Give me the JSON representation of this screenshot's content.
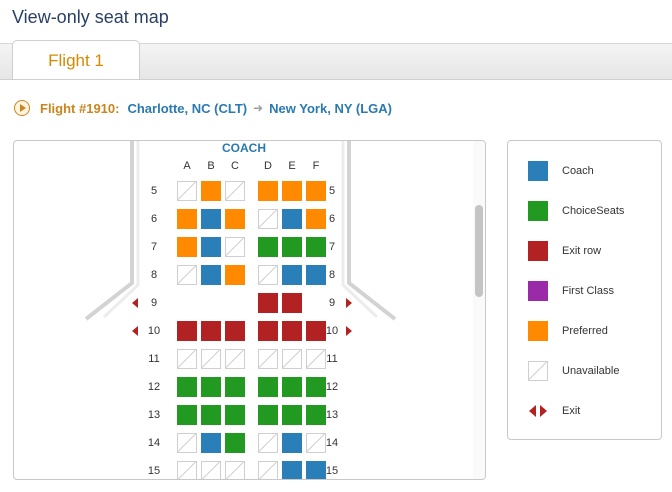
{
  "page": {
    "title": "View-only seat map"
  },
  "tabs": [
    {
      "label": "Flight 1",
      "active": true
    }
  ],
  "flight": {
    "number_label": "Flight #1910:",
    "origin": "Charlotte, NC  (CLT)",
    "destination": "New York, NY  (LGA)"
  },
  "seat_map": {
    "cabin": "COACH",
    "columns_left": [
      "A",
      "B",
      "C"
    ],
    "columns_right": [
      "D",
      "E",
      "F"
    ],
    "rows": [
      {
        "num": "5",
        "seats": [
          "unavailable",
          "preferred",
          "unavailable",
          "preferred",
          "preferred",
          "preferred"
        ],
        "exit": false
      },
      {
        "num": "6",
        "seats": [
          "preferred",
          "coach",
          "preferred",
          "unavailable",
          "coach",
          "preferred"
        ],
        "exit": false
      },
      {
        "num": "7",
        "seats": [
          "preferred",
          "coach",
          "unavailable",
          "choice",
          "choice",
          "choice"
        ],
        "exit": false
      },
      {
        "num": "8",
        "seats": [
          "unavailable",
          "coach",
          "preferred",
          "unavailable",
          "coach",
          "coach"
        ],
        "exit": false
      },
      {
        "num": "9",
        "seats": [
          "none",
          "none",
          "none",
          "exitrow",
          "exitrow",
          "none"
        ],
        "exit": true
      },
      {
        "num": "10",
        "seats": [
          "exitrow",
          "exitrow",
          "exitrow",
          "exitrow",
          "exitrow",
          "exitrow"
        ],
        "exit": true
      },
      {
        "num": "11",
        "seats": [
          "unavailable",
          "unavailable",
          "unavailable",
          "unavailable",
          "unavailable",
          "unavailable"
        ],
        "exit": false
      },
      {
        "num": "12",
        "seats": [
          "choice",
          "choice",
          "choice",
          "choice",
          "choice",
          "choice"
        ],
        "exit": false
      },
      {
        "num": "13",
        "seats": [
          "choice",
          "choice",
          "choice",
          "choice",
          "choice",
          "choice"
        ],
        "exit": false
      },
      {
        "num": "14",
        "seats": [
          "unavailable",
          "coach",
          "choice",
          "unavailable",
          "coach",
          "unavailable"
        ],
        "exit": false
      },
      {
        "num": "15",
        "seats": [
          "unavailable",
          "unavailable",
          "unavailable",
          "unavailable",
          "coach",
          "coach"
        ],
        "exit": false
      }
    ]
  },
  "legend": [
    {
      "key": "coach",
      "label": "Coach",
      "color": "#2a7fb8",
      "icon": "coach-swatch"
    },
    {
      "key": "choice",
      "label": "ChoiceSeats",
      "color": "#229a22",
      "icon": "choiceseats-swatch"
    },
    {
      "key": "exitrow",
      "label": "Exit row",
      "color": "#b22222",
      "icon": "exit-row-swatch"
    },
    {
      "key": "first",
      "label": "First Class",
      "color": "#9b2aa8",
      "icon": "first-class-swatch"
    },
    {
      "key": "preferred",
      "label": "Preferred",
      "color": "#ff8a00",
      "icon": "preferred-swatch"
    },
    {
      "key": "unavailable",
      "label": "Unavailable",
      "color": "#ffffff",
      "icon": "unavailable-swatch"
    },
    {
      "key": "exit",
      "label": "Exit",
      "color": "#b22222",
      "icon": "exit-arrows-icon"
    }
  ]
}
